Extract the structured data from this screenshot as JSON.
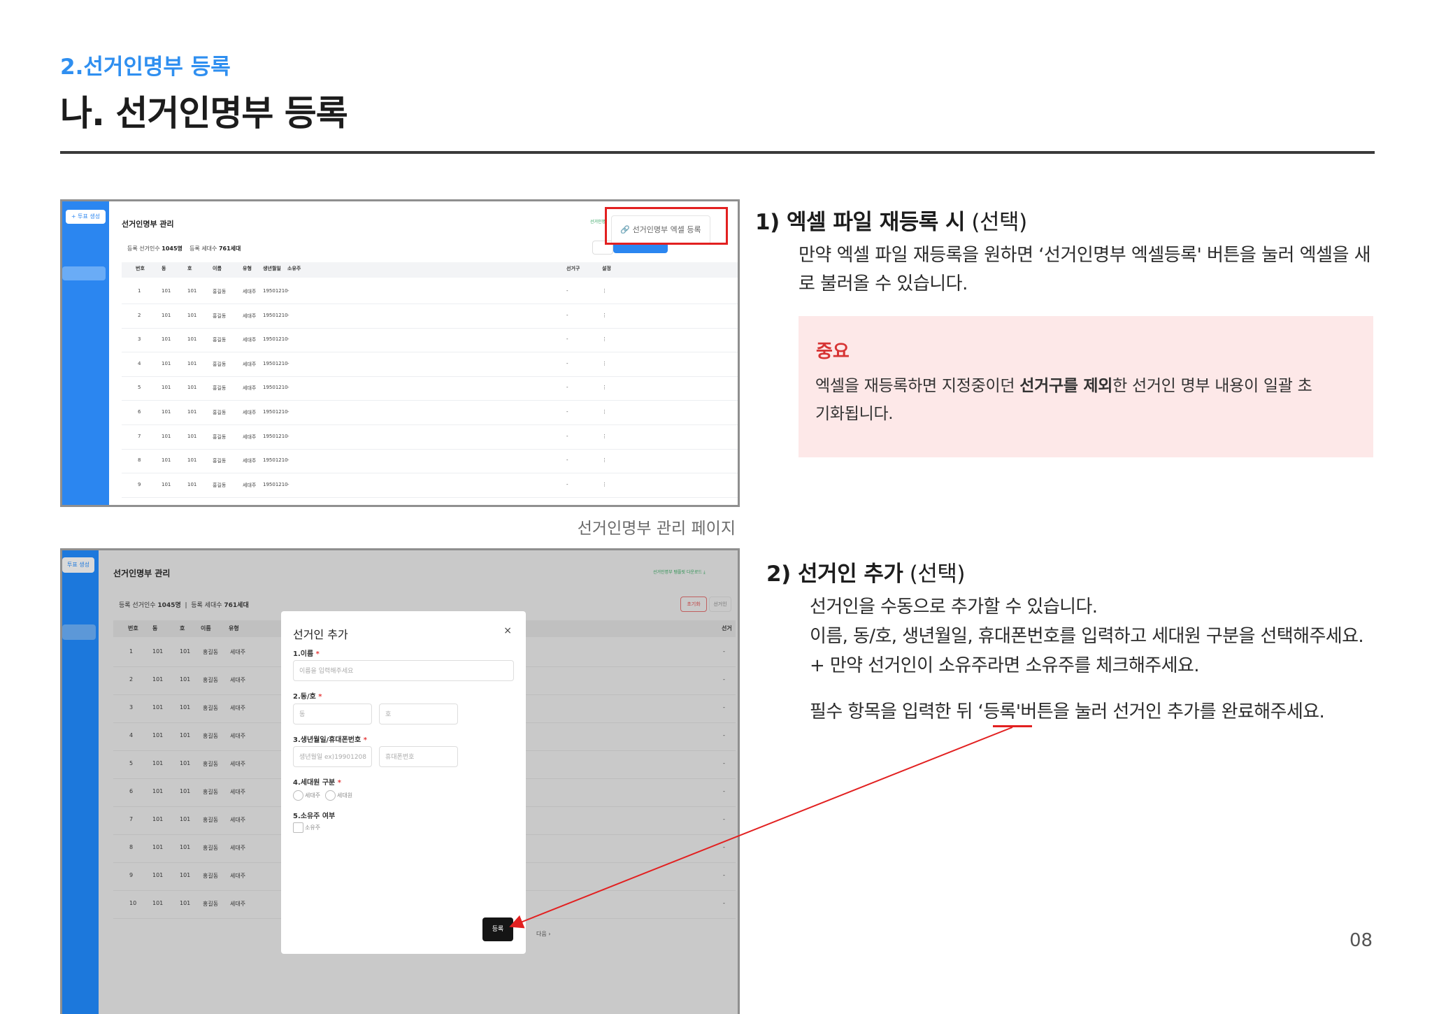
{
  "header": {
    "breadcrumb": "2.선거인명부 등록",
    "title": "나. 선거인명부 등록"
  },
  "shot1": {
    "new_button": "+ 투표 생성",
    "page_title": "선거인명부 관리",
    "count_label": "등록 선거인수",
    "count_value": "1045명",
    "household_label": "등록 세대수",
    "household_value": "761세대",
    "green_link": "선거인명",
    "excel_button": "선거인명부 엑셀 등록",
    "columns": [
      "번호",
      "동",
      "호",
      "이름",
      "유형",
      "생년월일",
      "소유주",
      "선거구",
      "설정"
    ],
    "rows": [
      [
        "1",
        "101",
        "101",
        "홍길동",
        "세대주",
        "19501210",
        "-",
        "-",
        "⋮"
      ],
      [
        "2",
        "101",
        "101",
        "홍길동",
        "세대주",
        "19501210",
        "-",
        "-",
        "⋮"
      ],
      [
        "3",
        "101",
        "101",
        "홍길동",
        "세대주",
        "19501210",
        "-",
        "-",
        "⋮"
      ],
      [
        "4",
        "101",
        "101",
        "홍길동",
        "세대주",
        "19501210",
        "-",
        "-",
        "⋮"
      ],
      [
        "5",
        "101",
        "101",
        "홍길동",
        "세대주",
        "19501210",
        "-",
        "-",
        "⋮"
      ],
      [
        "6",
        "101",
        "101",
        "홍길동",
        "세대주",
        "19501210",
        "-",
        "-",
        "⋮"
      ],
      [
        "7",
        "101",
        "101",
        "홍길동",
        "세대주",
        "19501210",
        "-",
        "-",
        "⋮"
      ],
      [
        "8",
        "101",
        "101",
        "홍길동",
        "세대주",
        "19501210",
        "-",
        "-",
        "⋮"
      ],
      [
        "9",
        "101",
        "101",
        "홍길동",
        "세대주",
        "19501210",
        "-",
        "-",
        "⋮"
      ]
    ]
  },
  "caption": "선거인명부 관리 페이지",
  "section1": {
    "heading_bold": "1) 엑셀 파일 재등록 시",
    "heading_rest": " (선택)",
    "body": "만약 엑셀 파일 재등록을 원하면 ‘선거인명부 엑셀등록' 버튼을 눌러 엑셀을 새로 불러올 수 있습니다.",
    "note_title": "중요",
    "note_pre": "엑셀을 재등록하면 지정중이던 ",
    "note_bold": "선거구를 제외",
    "note_post": "한 선거인 명부 내용이 일괄 초기화됩니다."
  },
  "shot2": {
    "new_button": "투표 생성",
    "page_title": "선거인명부 관리",
    "count_label": "등록 선거인수",
    "count_value": "1045명",
    "household_label": "등록 세대수",
    "household_value": "761세대",
    "green_link": "선거인명부 템플릿 다운로드 ⤓",
    "reset_button": "초기화",
    "other_button": "선거인",
    "columns": [
      "번호",
      "동",
      "호",
      "이름",
      "유형",
      "선거"
    ],
    "rows": [
      [
        "1",
        "101",
        "101",
        "홍길동",
        "세대주",
        "-"
      ],
      [
        "2",
        "101",
        "101",
        "홍길동",
        "세대주",
        "-"
      ],
      [
        "3",
        "101",
        "101",
        "홍길동",
        "세대주",
        "-"
      ],
      [
        "4",
        "101",
        "101",
        "홍길동",
        "세대주",
        "-"
      ],
      [
        "5",
        "101",
        "101",
        "홍길동",
        "세대주",
        "-"
      ],
      [
        "6",
        "101",
        "101",
        "홍길동",
        "세대주",
        "-"
      ],
      [
        "7",
        "101",
        "101",
        "홍길동",
        "세대주",
        "-"
      ],
      [
        "8",
        "101",
        "101",
        "홍길동",
        "세대주",
        "-"
      ],
      [
        "9",
        "101",
        "101",
        "홍길동",
        "세대주",
        "-"
      ],
      [
        "10",
        "101",
        "101",
        "홍길동",
        "세대주",
        "-"
      ]
    ],
    "next_label": "다음 ›",
    "modal": {
      "title": "선거인 추가",
      "close": "×",
      "name_label": "1.이름",
      "name_placeholder": "이름을 입력해주세요",
      "unit_label": "2.동/호",
      "dong_placeholder": "동",
      "ho_placeholder": "호",
      "birth_label": "3.생년월일/휴대폰번호",
      "birth_placeholder": "생년월일 ex)19901208",
      "phone_placeholder": "휴대폰번호",
      "member_label": "4.세대원 구분",
      "member_options": [
        "세대주",
        "세대원"
      ],
      "owner_label": "5.소유주 여부",
      "owner_option": "소유주",
      "submit": "등록",
      "required_mark": "*"
    }
  },
  "section2": {
    "heading_bold": "2) 선거인 추가",
    "heading_rest": " (선택)",
    "line1": "선거인을 수동으로 추가할 수 있습니다.",
    "line2": "이름, 동/호, 생년월일, 휴대폰번호를 입력하고 세대원 구분을 선택해주세요.",
    "line3": "+ 만약 선거인이 소유주라면 소유주를 체크해주세요.",
    "line4": "필수 항목을 입력한 뒤 ‘등록'버튼을 눌러 선거인 추가를 완료해주세요."
  },
  "page_number": "08",
  "colors": {
    "accent_blue": "#2f8ff0",
    "highlight_red": "#e22020",
    "note_bg": "#fde8e8"
  }
}
